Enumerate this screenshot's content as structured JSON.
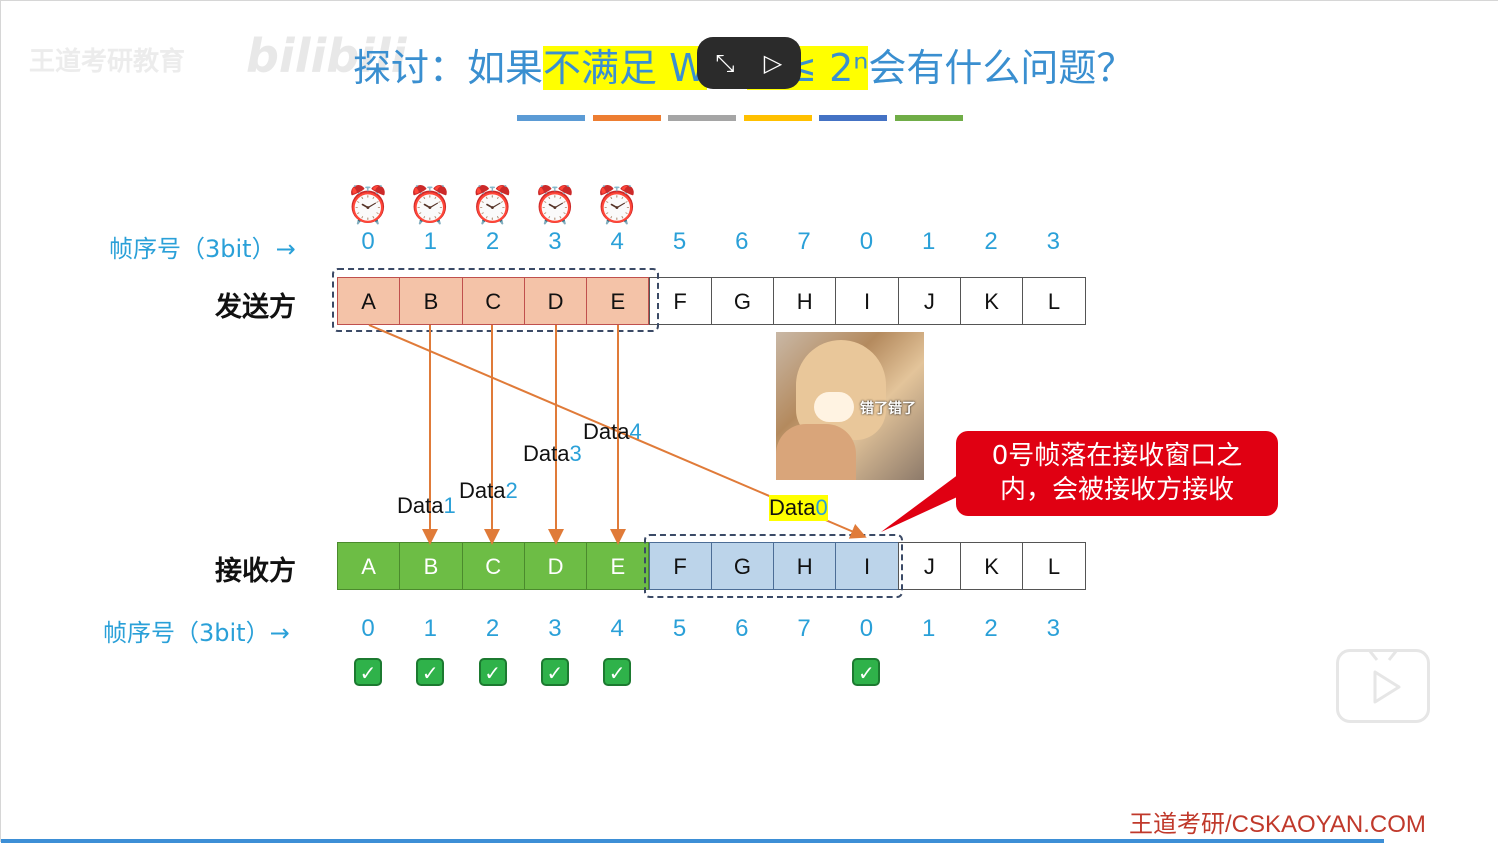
{
  "title": {
    "prefix": "探讨：如果",
    "highlight_left": "不满足 W",
    "highlight_right": "R ≤ 2ⁿ",
    "suffix": "会有什么问题？"
  },
  "watermark": {
    "left": "王道考研教育",
    "logo": "bilibili"
  },
  "video_controls": {
    "icon_left": "exit-fullscreen-icon",
    "icon_right": "ai-video-icon",
    "glyph_left": "⤡",
    "glyph_right": "▷"
  },
  "stripe_colors": [
    "#5b9bd5",
    "#ed7d31",
    "#a5a5a5",
    "#ffc000",
    "#4472c4",
    "#70ad47"
  ],
  "seq_label": "帧序号（3bit）→",
  "seq_numbers": [
    "0",
    "1",
    "2",
    "3",
    "4",
    "5",
    "6",
    "7",
    "0",
    "1",
    "2",
    "3"
  ],
  "sender": {
    "label": "发送方",
    "frames": [
      "A",
      "B",
      "C",
      "D",
      "E",
      "F",
      "G",
      "H",
      "I",
      "J",
      "K",
      "L"
    ],
    "sent_count": 5,
    "clock_count": 5
  },
  "receiver": {
    "label": "接收方",
    "frames": [
      "A",
      "B",
      "C",
      "D",
      "E",
      "F",
      "G",
      "H",
      "I",
      "J",
      "K",
      "L"
    ],
    "received_count": 5,
    "window_start": 5,
    "window_size": 4,
    "checked_indices": [
      0,
      1,
      2,
      3,
      4,
      8
    ]
  },
  "data_labels": [
    {
      "text": "Data",
      "num": "1"
    },
    {
      "text": "Data",
      "num": "2"
    },
    {
      "text": "Data",
      "num": "3"
    },
    {
      "text": "Data",
      "num": "4"
    },
    {
      "text": "Data",
      "num": "0"
    }
  ],
  "callout": {
    "line1": "0号帧落在接收窗口之",
    "line2": "内，会被接收方接收"
  },
  "meme": {
    "caption": "错了错了"
  },
  "brand": "王道考研/CSKAOYAN.COM",
  "colors": {
    "accent": "#2aa0d8",
    "arrow": "#e07b39",
    "callout": "#e00012",
    "sent": "#f4c3a8",
    "received": "#6dbd45",
    "window": "#bcd4ea"
  }
}
